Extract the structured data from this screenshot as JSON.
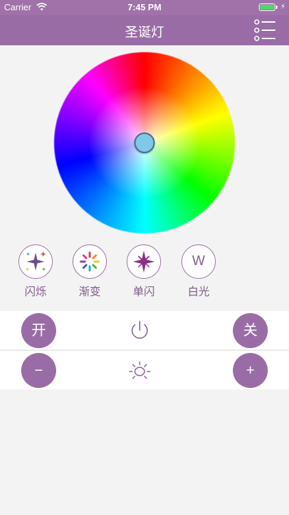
{
  "status_bar": {
    "carrier": "Carrier",
    "time": "7:45 PM",
    "wifi_icon": "wifi-icon",
    "battery_icon": "battery-icon",
    "charging_icon": "charging-bolt-icon",
    "battery_level": 1.0
  },
  "nav": {
    "title": "圣诞灯",
    "menu_icon": "list-menu-icon"
  },
  "color_wheel": {
    "selected_color": "#7fc8e8"
  },
  "modes": [
    {
      "label": "闪烁",
      "icon": "sparkle-icon"
    },
    {
      "label": "渐变",
      "icon": "gradient-burst-icon"
    },
    {
      "label": "单闪",
      "icon": "single-star-icon"
    },
    {
      "label": "白光",
      "icon_text": "W"
    }
  ],
  "power_row": {
    "on_label": "开",
    "off_label": "关",
    "icon": "power-icon"
  },
  "brightness_row": {
    "minus_label": "−",
    "plus_label": "+",
    "icon": "brightness-sun-icon"
  },
  "colors": {
    "accent": "#9a6ca6",
    "background": "#f4f3f3",
    "label_text": "#7e5a89"
  }
}
